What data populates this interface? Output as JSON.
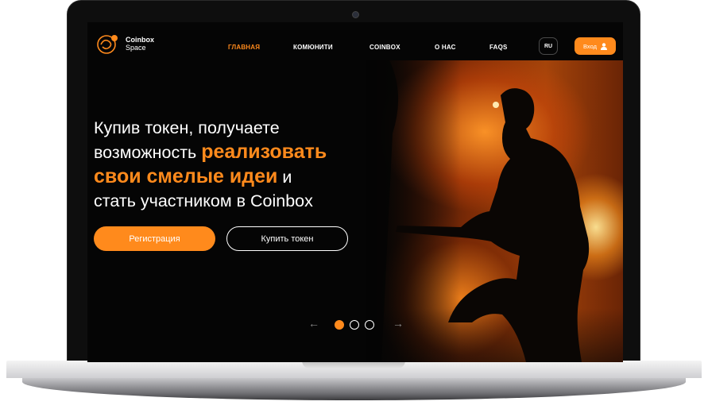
{
  "brand": {
    "name": "Coinbox",
    "sub": "Space",
    "accent": "#ff8a1c"
  },
  "nav": {
    "items": [
      "ГЛАВНАЯ",
      "КОМЮНИТИ",
      "COINBOX",
      "О НАС",
      "FAQS"
    ],
    "active": "ГЛАВНАЯ",
    "lang": "RU",
    "login": "Вход"
  },
  "hero": {
    "line1": "Купив токен, получаете",
    "line2a": "возможность ",
    "line2b": "реализовать",
    "line3a": "свои смелые идеи",
    "line3b": " и",
    "line4": "стать участником в Coinbox"
  },
  "buttons": {
    "register": "Регистрация",
    "buy": "Купить токен"
  },
  "slider": {
    "prev": "←",
    "next": "→",
    "active_index": 1,
    "count": 3
  }
}
